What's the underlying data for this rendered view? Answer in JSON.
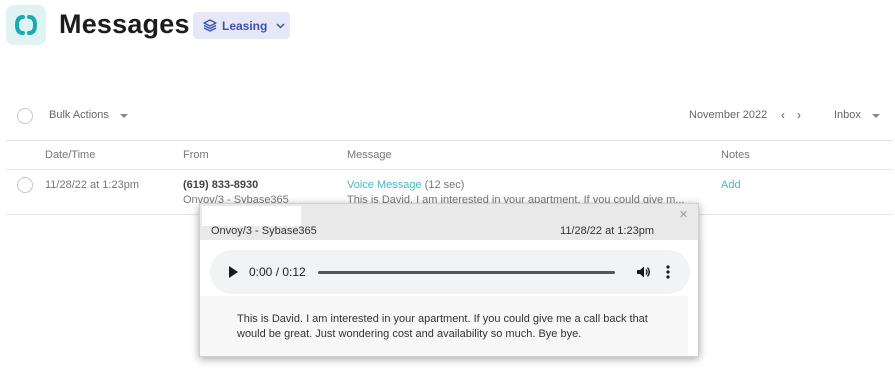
{
  "header": {
    "title": "Messages",
    "filter_label": "Leasing"
  },
  "toolbar": {
    "bulk_actions": "Bulk Actions",
    "month": "November 2022",
    "prev": "‹",
    "next": "›",
    "folder": "Inbox"
  },
  "table": {
    "columns": [
      "Date/Time",
      "From",
      "Message",
      "Notes"
    ],
    "rows": [
      {
        "datetime": "11/28/22 at 1:23pm",
        "from_number": "(619) 833-8930",
        "from_line": "Onvoy/3 - Sybase365",
        "message_type": "Voice Message",
        "message_duration": "(12 sec)",
        "message_preview": "This is David. I am interested in your apartment. If you could give m...",
        "notes_action": "Add"
      }
    ]
  },
  "popup": {
    "close": "×",
    "from": "Onvoy/3 - Sybase365",
    "time": "11/28/22 at 1:23pm",
    "player_time": "0:00 / 0:12",
    "progress": 0,
    "transcript": "This is David. I am interested in your apartment. If you could give me a call back that would be great. Just wondering cost and availability so much. Bye bye."
  },
  "colors": {
    "accent": "#46b8c4",
    "filter_bg": "#e6e8f8",
    "filter_text": "#3d4fb3",
    "logo_bg": "#dff3f3"
  },
  "icons": {
    "logo": "brackets-logo-icon",
    "filter": "layers-icon",
    "chevron": "chevron-down-icon",
    "play": "play-icon",
    "volume": "volume-icon",
    "more": "more-vertical-icon"
  }
}
